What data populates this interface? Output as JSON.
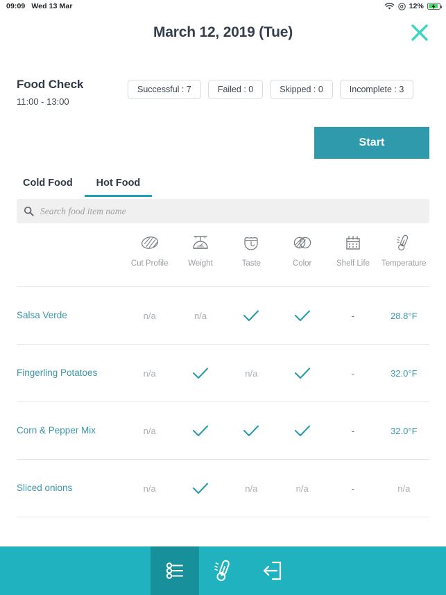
{
  "statusbar": {
    "time": "09:09",
    "date": "Wed 13 Mar",
    "battery_percent": "12%",
    "wifi_icon": "wifi-icon",
    "location_icon": "location-icon",
    "battery_icon": "battery-charging-icon"
  },
  "header": {
    "title": "March 12, 2019 (Tue)",
    "close_icon": "close-icon"
  },
  "check": {
    "title": "Food Check",
    "time_range": "11:00 - 13:00",
    "pills": [
      {
        "label": "Successful : 7"
      },
      {
        "label": "Failed : 0"
      },
      {
        "label": "Skipped : 0"
      },
      {
        "label": "Incomplete : 3"
      }
    ],
    "start_label": "Start"
  },
  "tabs": [
    {
      "label": "Cold Food",
      "active": false
    },
    {
      "label": "Hot Food",
      "active": true
    }
  ],
  "search": {
    "placeholder": "Search food item name",
    "value": "",
    "icon": "search-icon"
  },
  "table": {
    "columns": [
      {
        "label": "Cut Profile",
        "icon": "cut-profile-icon"
      },
      {
        "label": "Weight",
        "icon": "weight-scale-icon"
      },
      {
        "label": "Taste",
        "icon": "taste-tongue-icon"
      },
      {
        "label": "Color",
        "icon": "color-circles-icon"
      },
      {
        "label": "Shelf Life",
        "icon": "calendar-icon"
      },
      {
        "label": "Temperature",
        "icon": "thermometer-icon"
      }
    ],
    "rows": [
      {
        "name": "Salsa Verde",
        "cells": [
          "n/a",
          "n/a",
          "check",
          "check",
          "-",
          "28.8°F"
        ]
      },
      {
        "name": "Fingerling Potatoes",
        "cells": [
          "n/a",
          "check",
          "n/a",
          "check",
          "-",
          "32.0°F"
        ]
      },
      {
        "name": "Corn & Pepper Mix",
        "cells": [
          "n/a",
          "check",
          "check",
          "check",
          "-",
          "32.0°F"
        ]
      },
      {
        "name": "Sliced onions",
        "cells": [
          "n/a",
          "check",
          "n/a",
          "n/a",
          "-",
          "n/a"
        ]
      }
    ]
  },
  "bottomnav": [
    {
      "icon": "checklist-icon",
      "active": true
    },
    {
      "icon": "thermometer-icon",
      "active": false
    },
    {
      "icon": "logout-icon",
      "active": false
    }
  ],
  "colors": {
    "accent_teal": "#21b2c0",
    "start_button": "#2e9aac",
    "close_turquoise": "#3dd6c4",
    "link_teal": "#3d96a8",
    "tab_underline": "#1aa3b5",
    "battery_green": "#4cd964"
  }
}
